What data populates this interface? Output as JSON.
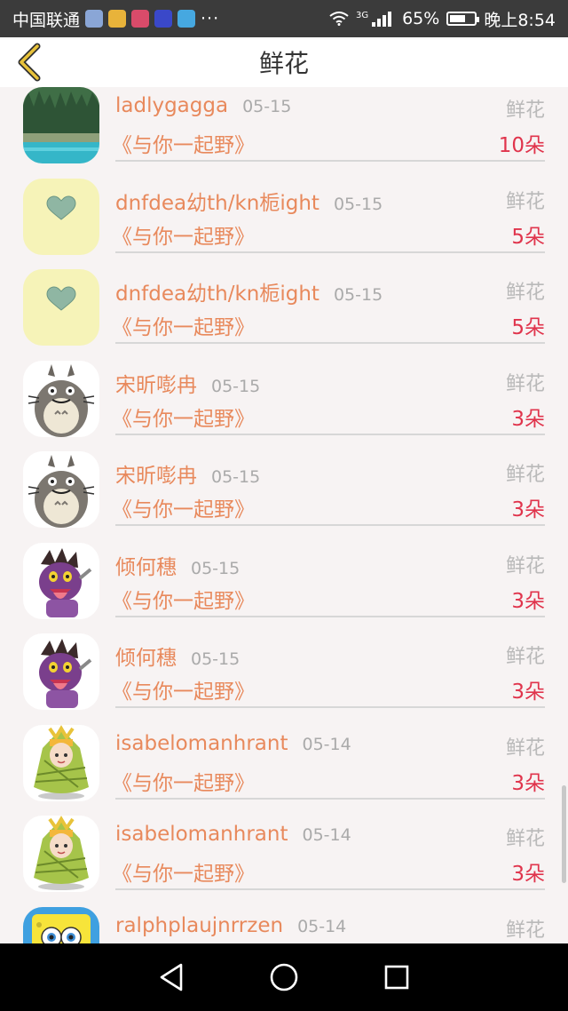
{
  "status_bar": {
    "carrier": "中国联通",
    "more": "···",
    "network": "3G",
    "battery_percent": "65%",
    "battery_level": 0.65,
    "time": "晚上8:54"
  },
  "header": {
    "title": "鲜花"
  },
  "records": [
    {
      "name": "ladlygagga",
      "date": "05-15",
      "type": "鲜花",
      "book": "《与你一起野》",
      "amount": "10朵",
      "avatar": "forest-lake"
    },
    {
      "name": "dnfdea幼th/kn栀ight",
      "date": "05-15",
      "type": "鲜花",
      "book": "《与你一起野》",
      "amount": "5朵",
      "avatar": "heart"
    },
    {
      "name": "dnfdea幼th/kn栀ight",
      "date": "05-15",
      "type": "鲜花",
      "book": "《与你一起野》",
      "amount": "5朵",
      "avatar": "heart"
    },
    {
      "name": "宋昕嘭冉",
      "date": "05-15",
      "type": "鲜花",
      "book": "《与你一起野》",
      "amount": "3朵",
      "avatar": "totoro"
    },
    {
      "name": "宋昕嘭冉",
      "date": "05-15",
      "type": "鲜花",
      "book": "《与你一起野》",
      "amount": "3朵",
      "avatar": "totoro"
    },
    {
      "name": "倾何穗",
      "date": "05-15",
      "type": "鲜花",
      "book": "《与你一起野》",
      "amount": "3朵",
      "avatar": "purple-monster"
    },
    {
      "name": "倾何穗",
      "date": "05-15",
      "type": "鲜花",
      "book": "《与你一起野》",
      "amount": "3朵",
      "avatar": "purple-monster"
    },
    {
      "name": "isabelomanhrant",
      "date": "05-14",
      "type": "鲜花",
      "book": "《与你一起野》",
      "amount": "3朵",
      "avatar": "zongzi-girl"
    },
    {
      "name": "isabelomanhrant",
      "date": "05-14",
      "type": "鲜花",
      "book": "《与你一起野》",
      "amount": "3朵",
      "avatar": "zongzi-girl"
    },
    {
      "name": "ralphplaujnrrzen",
      "date": "05-14",
      "type": "鲜花",
      "book": "",
      "amount": "",
      "avatar": "spongebob"
    }
  ],
  "colors": {
    "accent": "#e8895c",
    "amount": "#e0344c",
    "back_arrow": "#e8c23a"
  }
}
